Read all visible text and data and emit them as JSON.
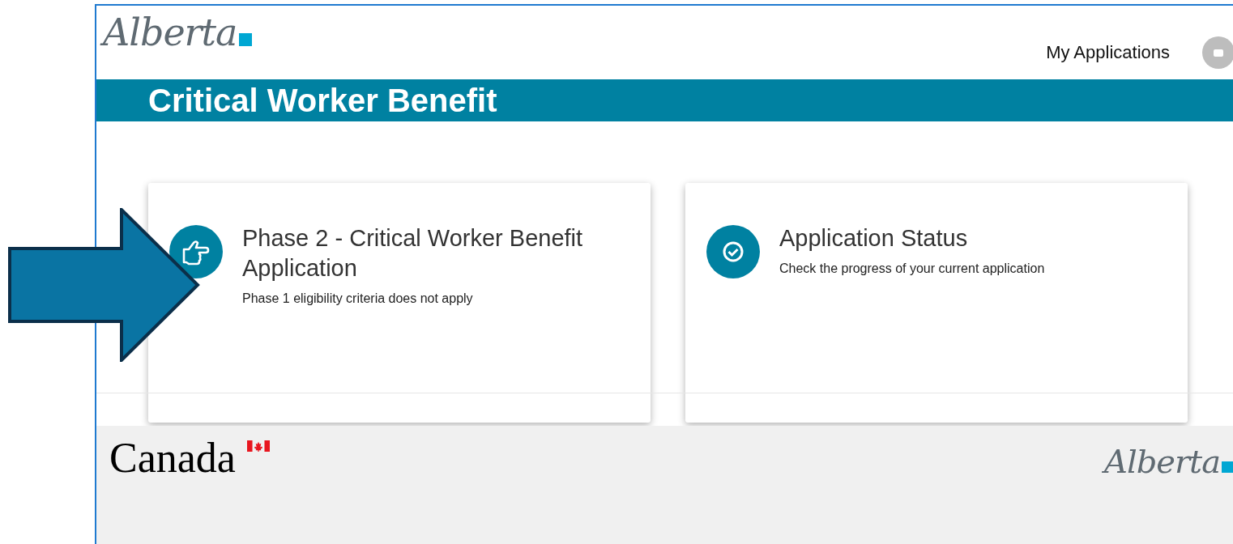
{
  "header": {
    "logo": "Alberta",
    "nav_link": "My Applications"
  },
  "banner": {
    "title": "Critical Worker Benefit"
  },
  "cards": [
    {
      "kind": "thumb",
      "title": "Phase 2 - Critical Worker Benefit Application",
      "description": "Phase 1 eligibility criteria does not apply"
    },
    {
      "kind": "check",
      "title": "Application Status",
      "description": "Check the progress of your current application"
    }
  ],
  "footer": {
    "left_logo": "Canada",
    "right_logo": "Alberta"
  }
}
